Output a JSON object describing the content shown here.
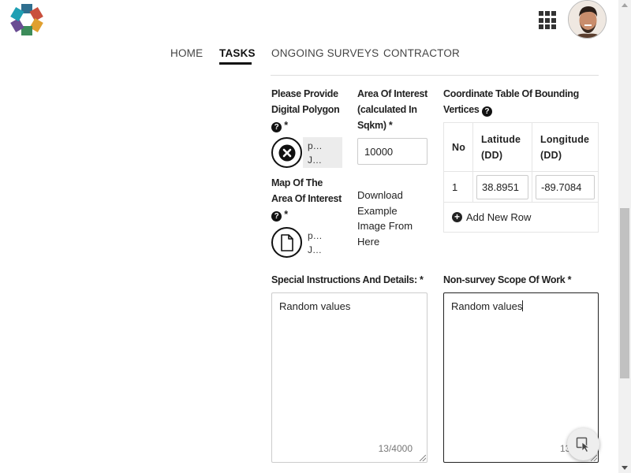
{
  "nav": {
    "items": [
      {
        "label": "HOME",
        "active": false
      },
      {
        "label": "TASKS",
        "active": true
      },
      {
        "label": "ONGOING SURVEYS",
        "active": false
      },
      {
        "label": "CONTRACTOR",
        "active": false
      }
    ]
  },
  "polygon": {
    "label_line1": "Please Provide",
    "label_line2": "Digital Polygon",
    "required": "*",
    "file_line1": "p…",
    "file_line2": "J…"
  },
  "aoi": {
    "label_line1": "Area Of Interest",
    "label_line2": "(calculated In",
    "label_line3": "Sqkm)",
    "required": "*",
    "value": "10000"
  },
  "map": {
    "label_line1": "Map Of The",
    "label_line2": "Area Of Interest",
    "required": "*",
    "file_line1": "p…",
    "file_line2": "J…"
  },
  "download": {
    "text": "Download Example Image From Here"
  },
  "coords": {
    "label_line1": "Coordinate Table Of Bounding",
    "label_line2": "Vertices",
    "headers": {
      "no": "No",
      "lat_1": "Latitude",
      "lat_2": "(DD)",
      "lon_1": "Longitude",
      "lon_2": "(DD)"
    },
    "rows": [
      {
        "no": "1",
        "lat": "38.8951",
        "lon": "-89.7084"
      }
    ],
    "add_row": "Add New Row"
  },
  "special": {
    "label": "Special Instructions And Details:",
    "required": "*",
    "value": "Random values",
    "counter": "13/4000"
  },
  "nonsurvey": {
    "label": "Non-survey Scope Of Work",
    "required": "*",
    "value": "Random values",
    "counter": "13/40"
  },
  "icons": {
    "help": "?",
    "plus": "+"
  }
}
